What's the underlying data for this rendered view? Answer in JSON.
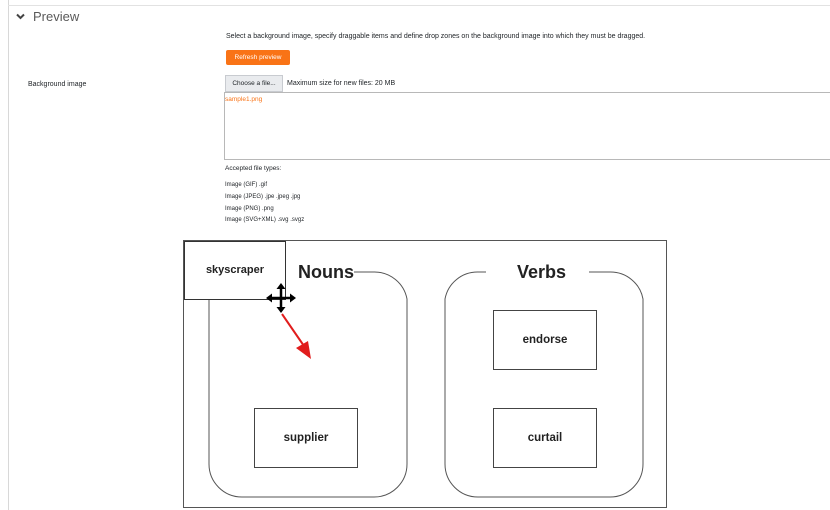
{
  "section": {
    "title": "Preview",
    "description": "Select a background image, specify draggable items and define drop zones on the background image into which they must be dragged.",
    "refresh_label": "Refresh preview"
  },
  "background_image": {
    "label": "Background image",
    "choose_label": "Choose a file...",
    "max_size": "Maximum size for new files: 20 MB",
    "file_name": "sample1.png",
    "accepted_label": "Accepted file types:",
    "types": [
      "Image (GIF) .gif",
      "Image (JPEG) .jpe .jpeg .jpg",
      "Image (PNG) .png",
      "Image (SVG+XML) .svg .svgz"
    ]
  },
  "preview": {
    "nouns_heading": "Nouns",
    "verbs_heading": "Verbs",
    "drop_zones": [
      "supplier",
      "endorse",
      "curtail"
    ],
    "drag_item": "skyscraper"
  },
  "colors": {
    "accent": "#f97316",
    "arrow": "#e11d1d"
  },
  "icons": {
    "collapse": "chevron-down-icon",
    "cursor": "move-cursor-icon",
    "pointer": "red-arrow-icon"
  }
}
